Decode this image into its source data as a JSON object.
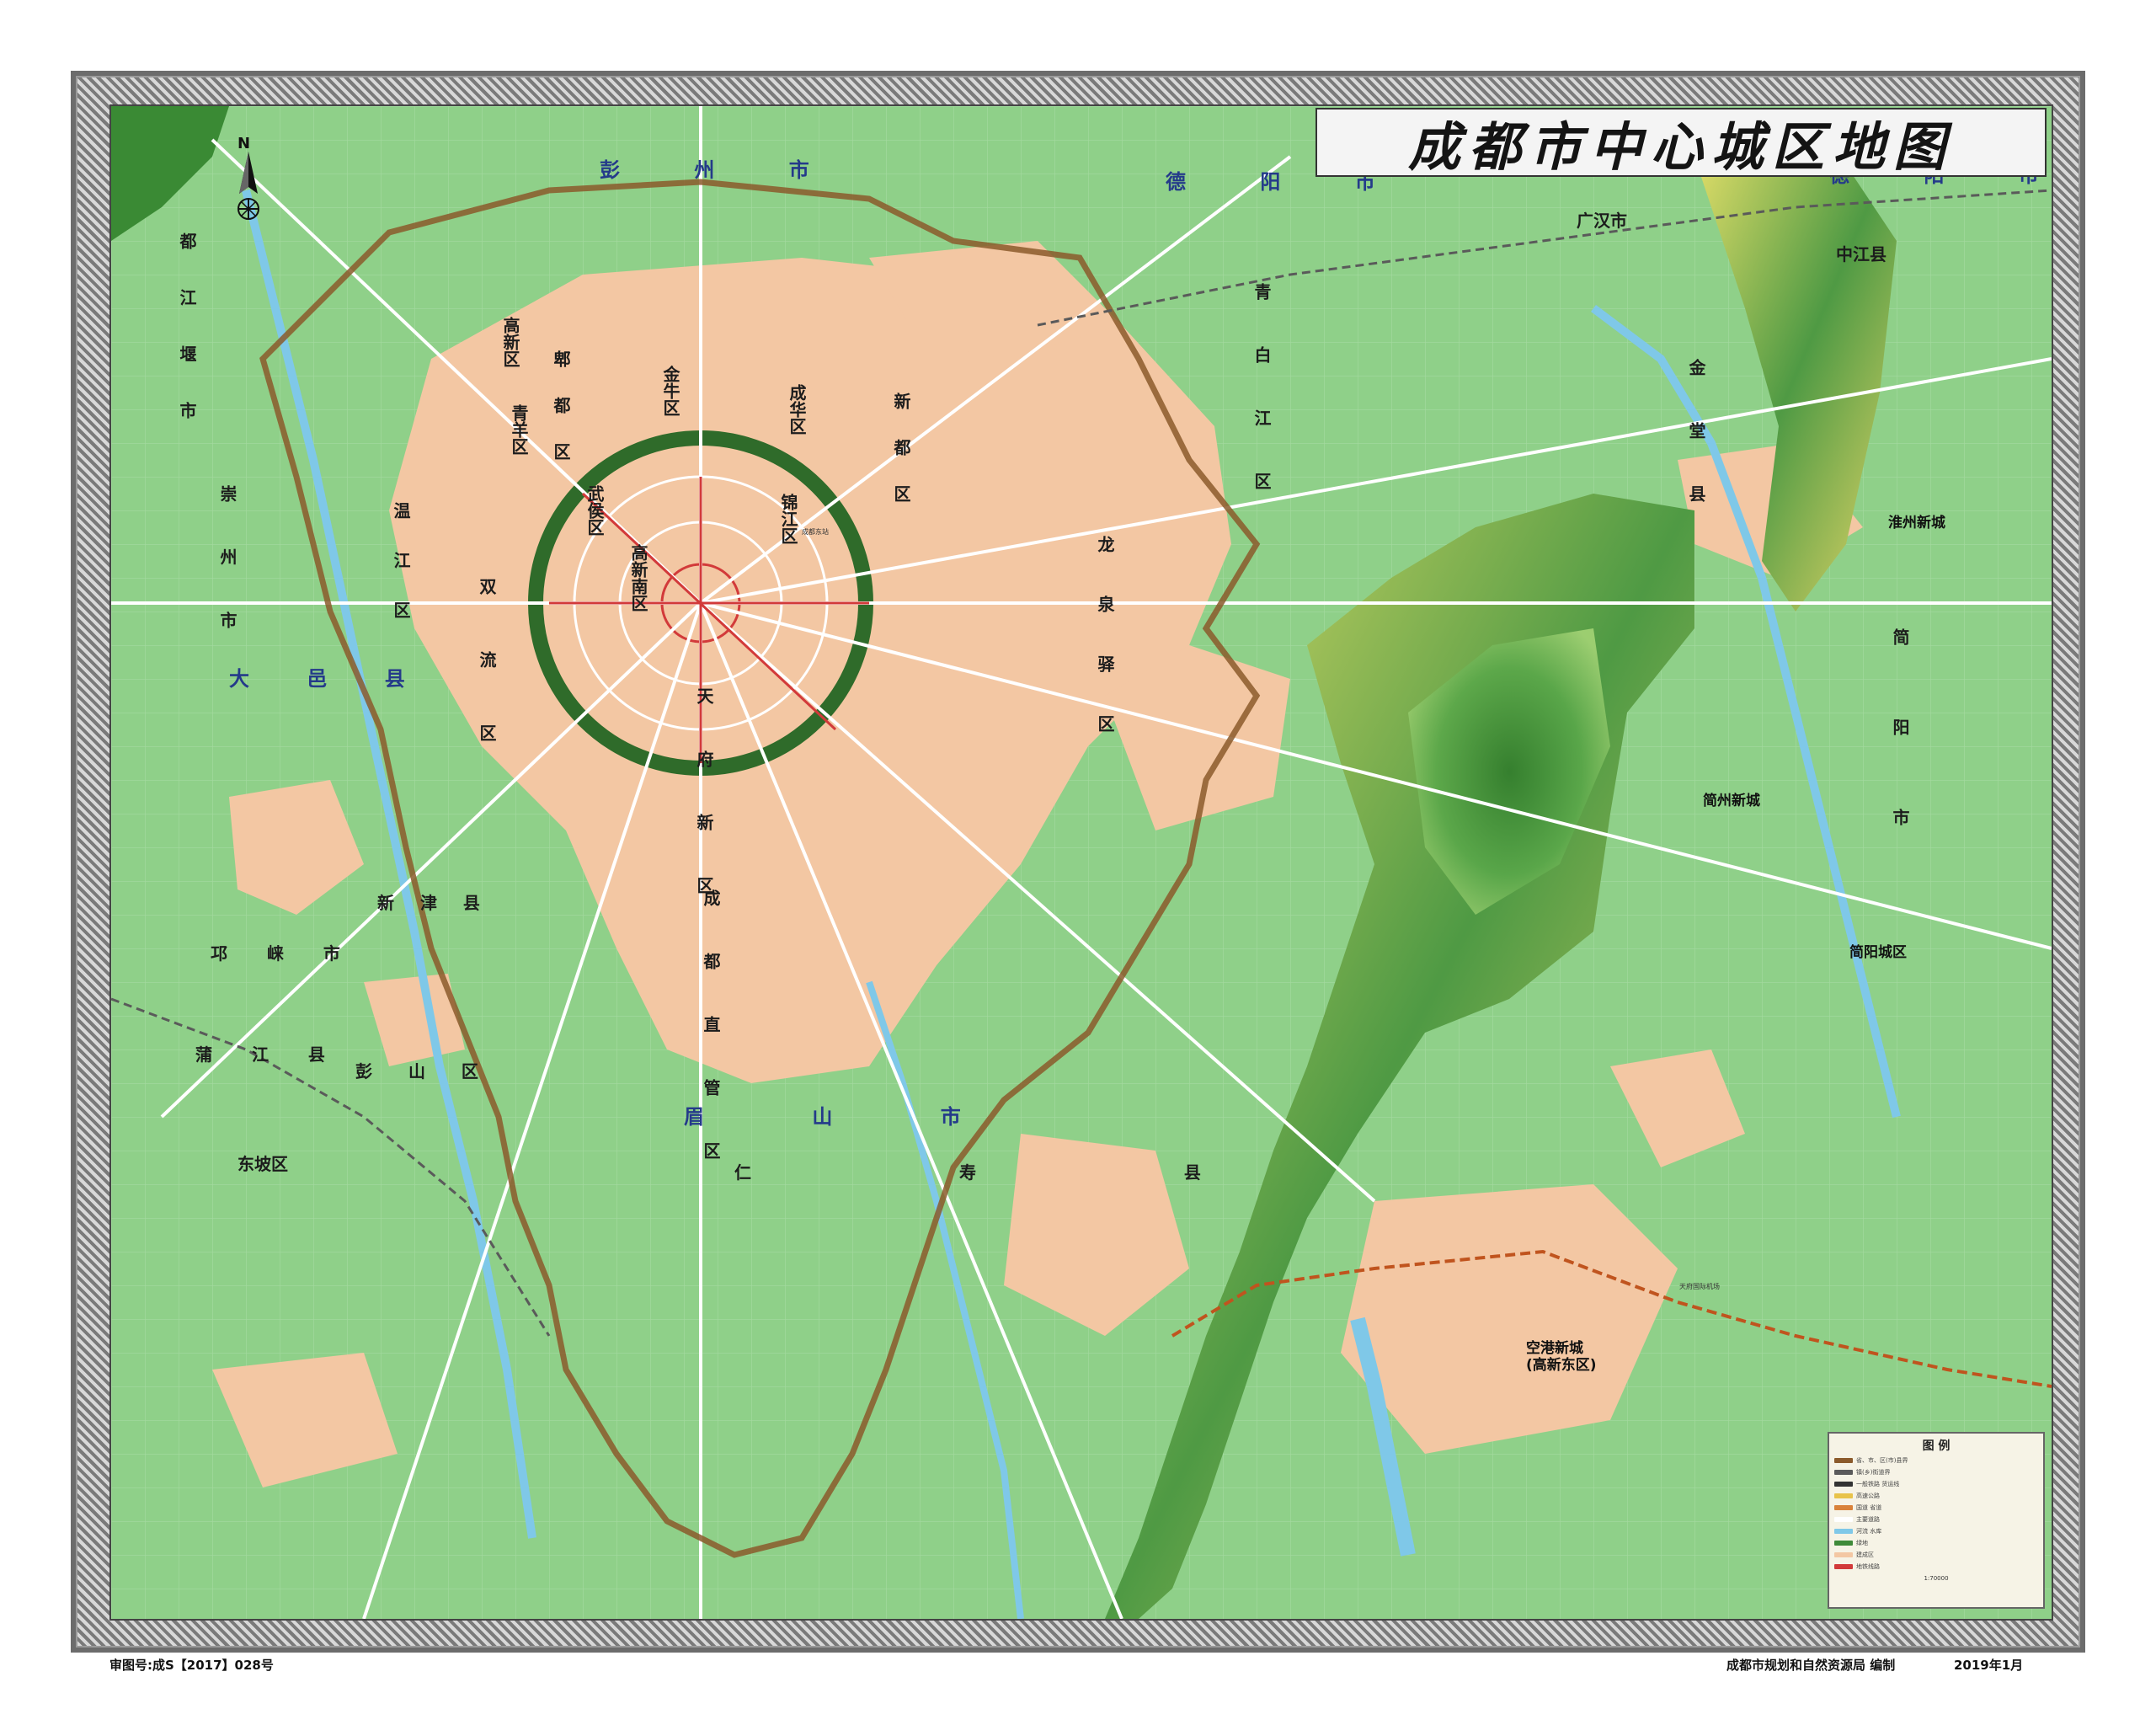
{
  "map": {
    "title": "成都市中心城区地图",
    "approval_no": "审图号:成S【2017】028号",
    "publisher": "成都市规划和自然资源局 编制",
    "date": "2019年1月",
    "north_label": "N",
    "legend": {
      "title": "图 例",
      "scale_text": "1:70000",
      "items": [
        {
          "label": "省、市、区(市)县界",
          "color": "#8b5a2b"
        },
        {
          "label": "镇(乡)街道界",
          "color": "#5a5a5a"
        },
        {
          "label": "一般铁路 货运线",
          "color": "#333333"
        },
        {
          "label": "高速公路",
          "color": "#e8c34a"
        },
        {
          "label": "国道 省道",
          "color": "#d9823a"
        },
        {
          "label": "主要道路",
          "color": "#ffffff"
        },
        {
          "label": "河流 水库",
          "color": "#7fc8e8"
        },
        {
          "label": "绿地",
          "color": "#3f8a3a"
        },
        {
          "label": "建成区",
          "color": "#f3c7a3"
        },
        {
          "label": "地铁线路",
          "color": "#d23a3a"
        }
      ]
    },
    "regions": [
      {
        "id": "pengzhou",
        "label": "彭 州 市"
      },
      {
        "id": "deyang1",
        "label": "德 阳 市"
      },
      {
        "id": "deyang2",
        "label": "德 阳 市"
      },
      {
        "id": "guanghan",
        "label": "广汉市"
      },
      {
        "id": "zhongjiang",
        "label": "中江县"
      },
      {
        "id": "pixian",
        "label": "郫 都 区"
      },
      {
        "id": "xindu",
        "label": "新 都 区"
      },
      {
        "id": "qingbaijiang",
        "label": "青 白 江 区"
      },
      {
        "id": "jintang",
        "label": "金 堂 县"
      },
      {
        "id": "dujiangyan",
        "label": "都 江 堰 市"
      },
      {
        "id": "wenjiang",
        "label": "温 江 区"
      },
      {
        "id": "chongzhou",
        "label": "崇 州 市"
      },
      {
        "id": "longquanyi",
        "label": "龙 泉 驿 区"
      },
      {
        "id": "jianyang",
        "label": "简 阳 市"
      },
      {
        "id": "shuangliu",
        "label": "双 流 区"
      },
      {
        "id": "tianfu",
        "label": "天 府 新 区"
      },
      {
        "id": "chengdu_zhiguan",
        "label": "成 都 直 管 区"
      },
      {
        "id": "dayi",
        "label": "大 邑 县"
      },
      {
        "id": "xinjin",
        "label": "新 津 县"
      },
      {
        "id": "qionglai",
        "label": "邛 崃 市"
      },
      {
        "id": "pujiang",
        "label": "蒲 江 县"
      },
      {
        "id": "pengshan",
        "label": "彭 山 区"
      },
      {
        "id": "meishan",
        "label": "眉 山 市"
      },
      {
        "id": "renshou",
        "label": "仁 寿 县"
      },
      {
        "id": "dongpo",
        "label": "东坡区"
      },
      {
        "id": "jinniu",
        "label": "金牛区"
      },
      {
        "id": "chenghua",
        "label": "成华区"
      },
      {
        "id": "qingyang",
        "label": "青羊区"
      },
      {
        "id": "wuhou",
        "label": "武侯区"
      },
      {
        "id": "jinjiang",
        "label": "锦江区"
      },
      {
        "id": "gaoxin",
        "label": "高新区"
      },
      {
        "id": "gaoxinnan",
        "label": "高新南区"
      },
      {
        "id": "jianyang_city",
        "label": "简阳城区"
      }
    ],
    "new_towns": [
      {
        "id": "huaizhou",
        "label": "淮州新城"
      },
      {
        "id": "jianzhou",
        "label": "简州新城"
      },
      {
        "id": "konggang",
        "label": "空港新城"
      },
      {
        "id": "konggang2",
        "label": "(高新东区)"
      }
    ],
    "poi": {
      "airport": "天府国际机场",
      "station": "成都东站"
    },
    "colors": {
      "terrain_green": "#8fd089",
      "urban": "#f3c7a3",
      "mountain_dark": "#3f8a3a",
      "mountain_light": "#c8e07a",
      "water": "#7fc8e8",
      "boundary": "#8b5a2b",
      "ring_green": "#2f6b2a",
      "road": "#ffffff"
    }
  }
}
